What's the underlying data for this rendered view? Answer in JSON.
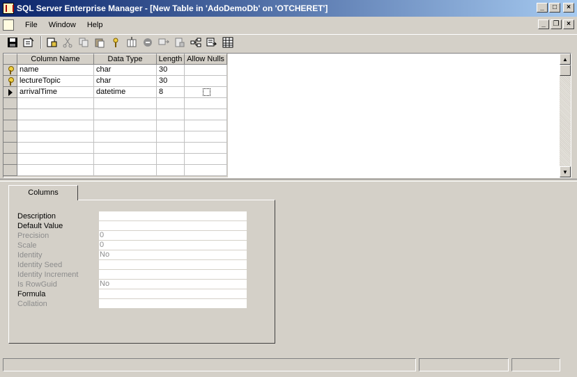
{
  "window": {
    "title": "SQL Server Enterprise Manager - [New Table in 'AdoDemoDb' on 'OTCHERET']",
    "buttons": [
      "_",
      "□",
      "×"
    ]
  },
  "menubar": {
    "items": [
      {
        "label": "File",
        "key": "F"
      },
      {
        "label": "Window",
        "key": "W"
      },
      {
        "label": "Help",
        "key": "H"
      }
    ],
    "mdi_buttons": [
      "_",
      "❐",
      "×"
    ]
  },
  "toolbar": {
    "icons": [
      "save-icon",
      "properties-icon",
      "generate-script-icon",
      "cut-icon",
      "copy-icon",
      "paste-icon",
      "primary-key-icon",
      "insert-column-icon",
      "delete-column-icon",
      "manage-relationships-icon",
      "manage-indexes-icon",
      "manage-constraints-icon",
      "manage-triggers-icon",
      "table-view-icon"
    ]
  },
  "grid": {
    "headers": [
      "Column Name",
      "Data Type",
      "Length",
      "Allow Nulls"
    ],
    "rows": [
      {
        "indicator": "key",
        "name": "name",
        "type": "char",
        "length": "30",
        "nulls": false,
        "show_checkbox": false
      },
      {
        "indicator": "key",
        "name": "lectureTopic",
        "type": "char",
        "length": "30",
        "nulls": false,
        "show_checkbox": false
      },
      {
        "indicator": "current",
        "name": "arrivalTime",
        "type": "datetime",
        "length": "8",
        "nulls": false,
        "show_checkbox": true
      }
    ],
    "empty_rows": 7
  },
  "properties": {
    "tab_label": "Columns",
    "rows": [
      {
        "label": "Description",
        "value": "",
        "enabled": true
      },
      {
        "label": "Default Value",
        "value": "",
        "enabled": true
      },
      {
        "label": "Precision",
        "value": "0",
        "enabled": false
      },
      {
        "label": "Scale",
        "value": "0",
        "enabled": false
      },
      {
        "label": "Identity",
        "value": "No",
        "enabled": false
      },
      {
        "label": "Identity Seed",
        "value": "",
        "enabled": false
      },
      {
        "label": "Identity Increment",
        "value": "",
        "enabled": false
      },
      {
        "label": "Is RowGuid",
        "value": "No",
        "enabled": false
      },
      {
        "label": "Formula",
        "value": "",
        "enabled": true
      },
      {
        "label": "Collation",
        "value": "",
        "enabled": false
      }
    ]
  },
  "statusbar": {
    "panes": [
      "",
      "",
      ""
    ]
  }
}
